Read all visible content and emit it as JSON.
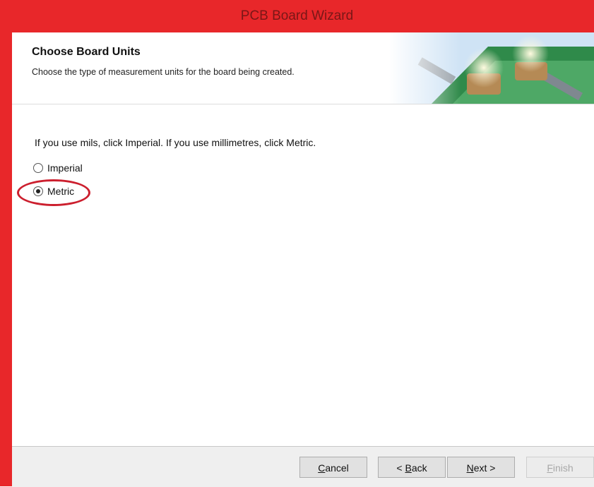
{
  "window": {
    "title": "PCB Board Wizard"
  },
  "header": {
    "title": "Choose Board Units",
    "subtitle": "Choose the type of measurement units for the board being created."
  },
  "main": {
    "prompt": "If you use mils, click Imperial. If you use millimetres, click Metric.",
    "options": [
      {
        "label": "Imperial",
        "selected": false
      },
      {
        "label": "Metric",
        "selected": true
      }
    ]
  },
  "footer": {
    "buttons": [
      {
        "mnemonic": "C",
        "rest": "ancel",
        "enabled": true
      },
      {
        "prefix": "< ",
        "mnemonic": "B",
        "rest": "ack",
        "enabled": true
      },
      {
        "mnemonic": "N",
        "rest": "ext >",
        "enabled": true
      },
      {
        "mnemonic": "F",
        "rest": "inish",
        "enabled": false
      }
    ]
  },
  "colors": {
    "titlebar": "#e8272a",
    "annotation": "#cc1f2e"
  }
}
